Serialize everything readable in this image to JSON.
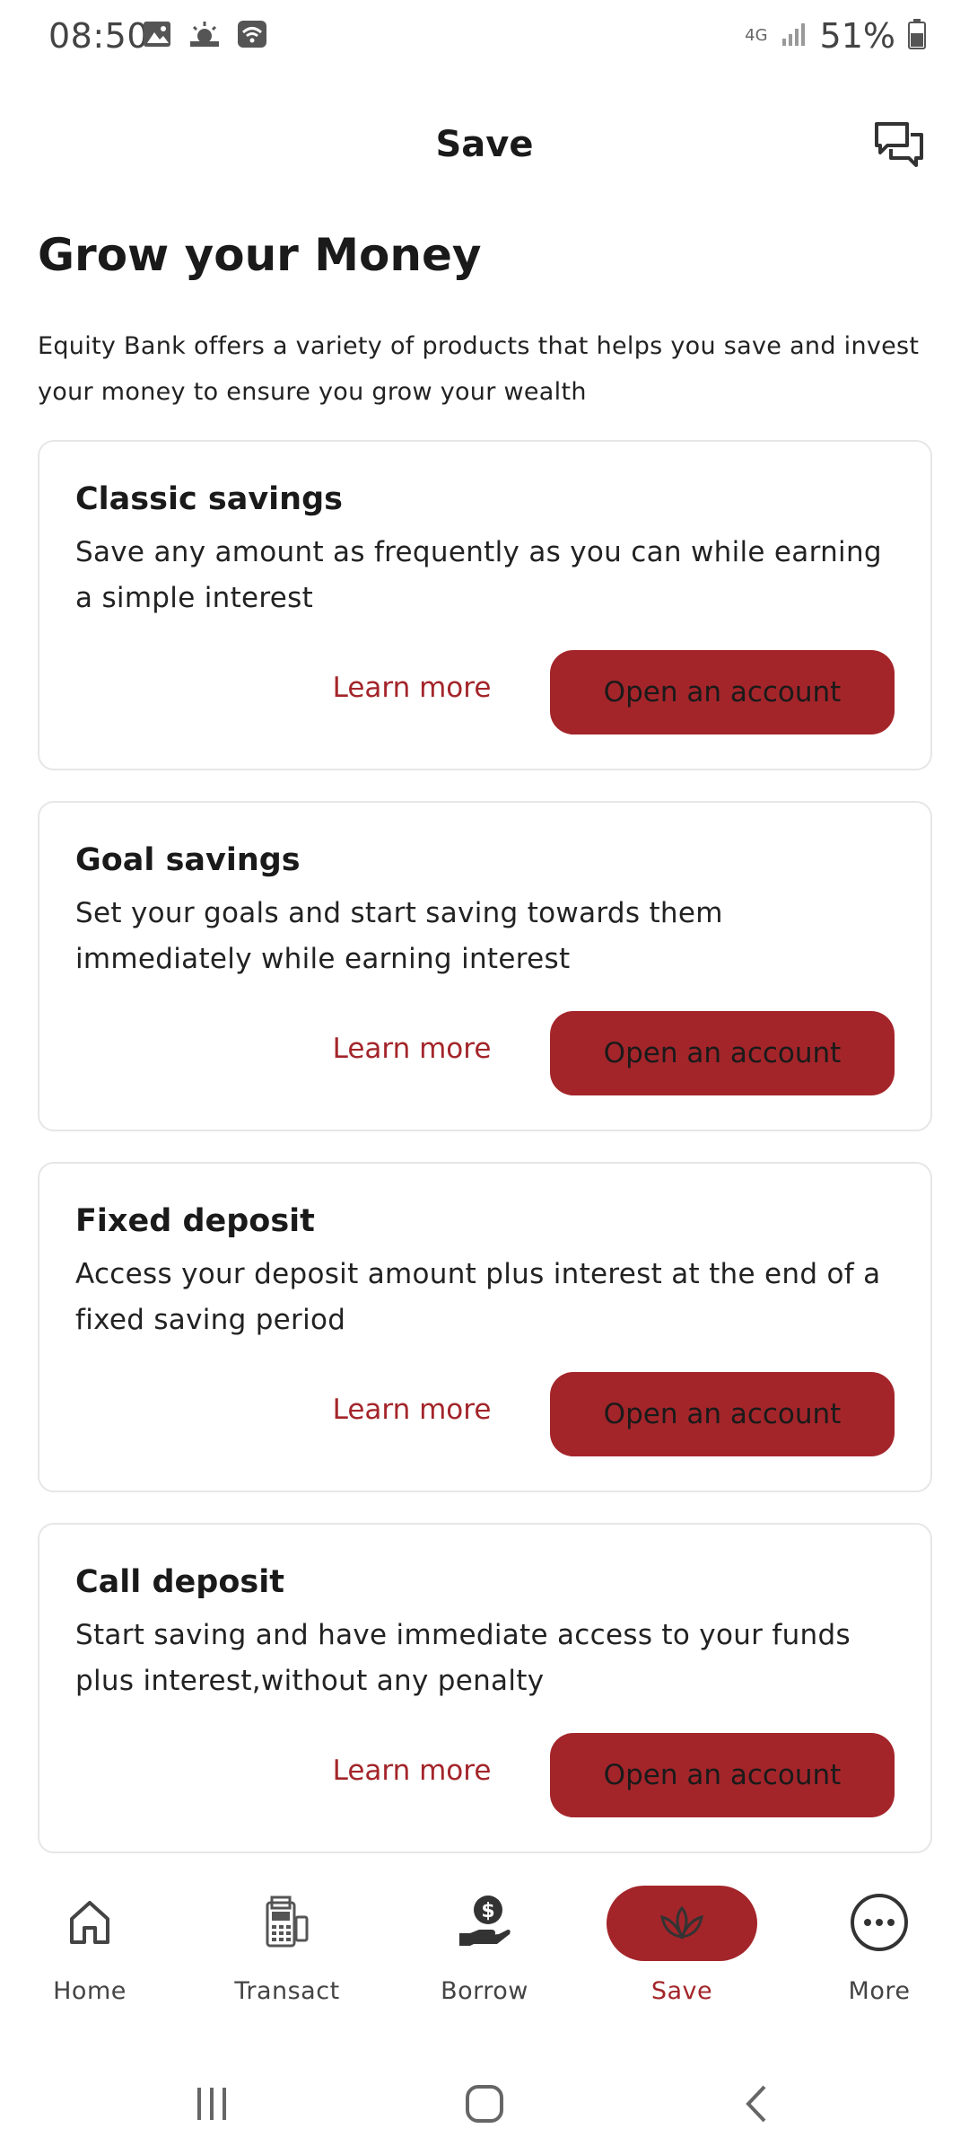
{
  "status_bar": {
    "time": "08:50",
    "network": "4G",
    "battery": "51%",
    "icons": [
      "gallery-icon",
      "weather-icon",
      "wifi-icon",
      "signal-icon",
      "battery-icon"
    ]
  },
  "header": {
    "title": "Save",
    "chat_icon": "chat-icon"
  },
  "intro": {
    "heading": "Grow your Money",
    "description": "Equity Bank offers a variety of products that helps you save and invest your money to ensure you grow your wealth"
  },
  "products": [
    {
      "title": "Classic savings",
      "description": "Save any amount as frequently as you can while earning a simple interest",
      "learn_more": "Learn more",
      "open_account": "Open an account"
    },
    {
      "title": "Goal savings",
      "description": "Set your goals and start saving towards them immediately while earning interest",
      "learn_more": "Learn more",
      "open_account": "Open an account"
    },
    {
      "title": "Fixed deposit",
      "description": "Access your deposit amount plus interest at the end of a fixed saving period",
      "learn_more": "Learn more",
      "open_account": "Open an account"
    },
    {
      "title": "Call deposit",
      "description": "Start saving and have immediate access to your funds plus interest,without any penalty",
      "learn_more": "Learn more",
      "open_account": "Open an account"
    }
  ],
  "bottom_nav": {
    "items": [
      {
        "label": "Home",
        "icon": "home-icon"
      },
      {
        "label": "Transact",
        "icon": "pos-terminal-icon"
      },
      {
        "label": "Borrow",
        "icon": "money-hand-icon"
      },
      {
        "label": "Save",
        "icon": "lotus-icon",
        "active": true
      },
      {
        "label": "More",
        "icon": "more-icon"
      }
    ]
  },
  "colors": {
    "accent": "#a3252a",
    "text": "#1a1a1a",
    "border": "#e6e6e6"
  }
}
